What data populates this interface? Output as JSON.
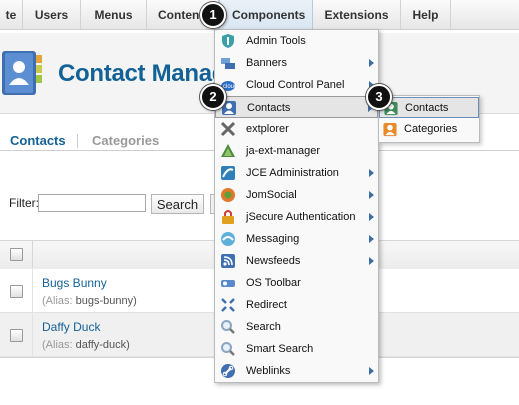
{
  "menubar": {
    "items": [
      {
        "label": "te"
      },
      {
        "label": "Users"
      },
      {
        "label": "Menus"
      },
      {
        "label": "Content"
      },
      {
        "label": "Components"
      },
      {
        "label": "Extensions"
      },
      {
        "label": "Help"
      }
    ]
  },
  "page": {
    "title": "Contact Manager"
  },
  "tabs": [
    {
      "label": "Contacts"
    },
    {
      "label": "Categories"
    }
  ],
  "filter": {
    "label": "Filter:",
    "value": "",
    "search_label": "Search"
  },
  "contacts": [
    {
      "name": "Bugs Bunny",
      "alias_key": "(Alias:",
      "alias_value": "bugs-bunny)"
    },
    {
      "name": "Daffy Duck",
      "alias_key": "(Alias:",
      "alias_value": "daffy-duck)"
    }
  ],
  "components_menu": {
    "items": [
      {
        "label": "Admin Tools",
        "icon": "shield-icon",
        "has_submenu": false
      },
      {
        "label": "Banners",
        "icon": "banners-icon",
        "has_submenu": true
      },
      {
        "label": "Cloud Control Panel",
        "icon": "cloud-icon",
        "has_submenu": true
      },
      {
        "label": "Contacts",
        "icon": "contact-person-icon",
        "has_submenu": true
      },
      {
        "label": "extplorer",
        "icon": "tools-x-icon",
        "has_submenu": false
      },
      {
        "label": "ja-ext-manager",
        "icon": "stack-icon",
        "has_submenu": false
      },
      {
        "label": "JCE Administration",
        "icon": "jce-icon",
        "has_submenu": true
      },
      {
        "label": "JomSocial",
        "icon": "jomsocial-icon",
        "has_submenu": true
      },
      {
        "label": "jSecure Authentication",
        "icon": "lock-icon",
        "has_submenu": true
      },
      {
        "label": "Messaging",
        "icon": "messaging-icon",
        "has_submenu": true
      },
      {
        "label": "Newsfeeds",
        "icon": "rss-icon",
        "has_submenu": true
      },
      {
        "label": "OS Toolbar",
        "icon": "toolbar-icon",
        "has_submenu": false
      },
      {
        "label": "Redirect",
        "icon": "redirect-arrows-icon",
        "has_submenu": false
      },
      {
        "label": "Search",
        "icon": "magnifier-icon",
        "has_submenu": false
      },
      {
        "label": "Smart Search",
        "icon": "magnifier-icon",
        "has_submenu": false
      },
      {
        "label": "Weblinks",
        "icon": "link-icon",
        "has_submenu": true
      }
    ]
  },
  "contacts_submenu": {
    "items": [
      {
        "label": "Contacts",
        "icon": "contact-person-icon"
      },
      {
        "label": "Categories",
        "icon": "categories-icon"
      }
    ]
  },
  "callouts": [
    "1",
    "2",
    "3"
  ],
  "colors": {
    "link": "#146295",
    "menu_arrow": "#3a6ea5",
    "badge": "#111111"
  }
}
